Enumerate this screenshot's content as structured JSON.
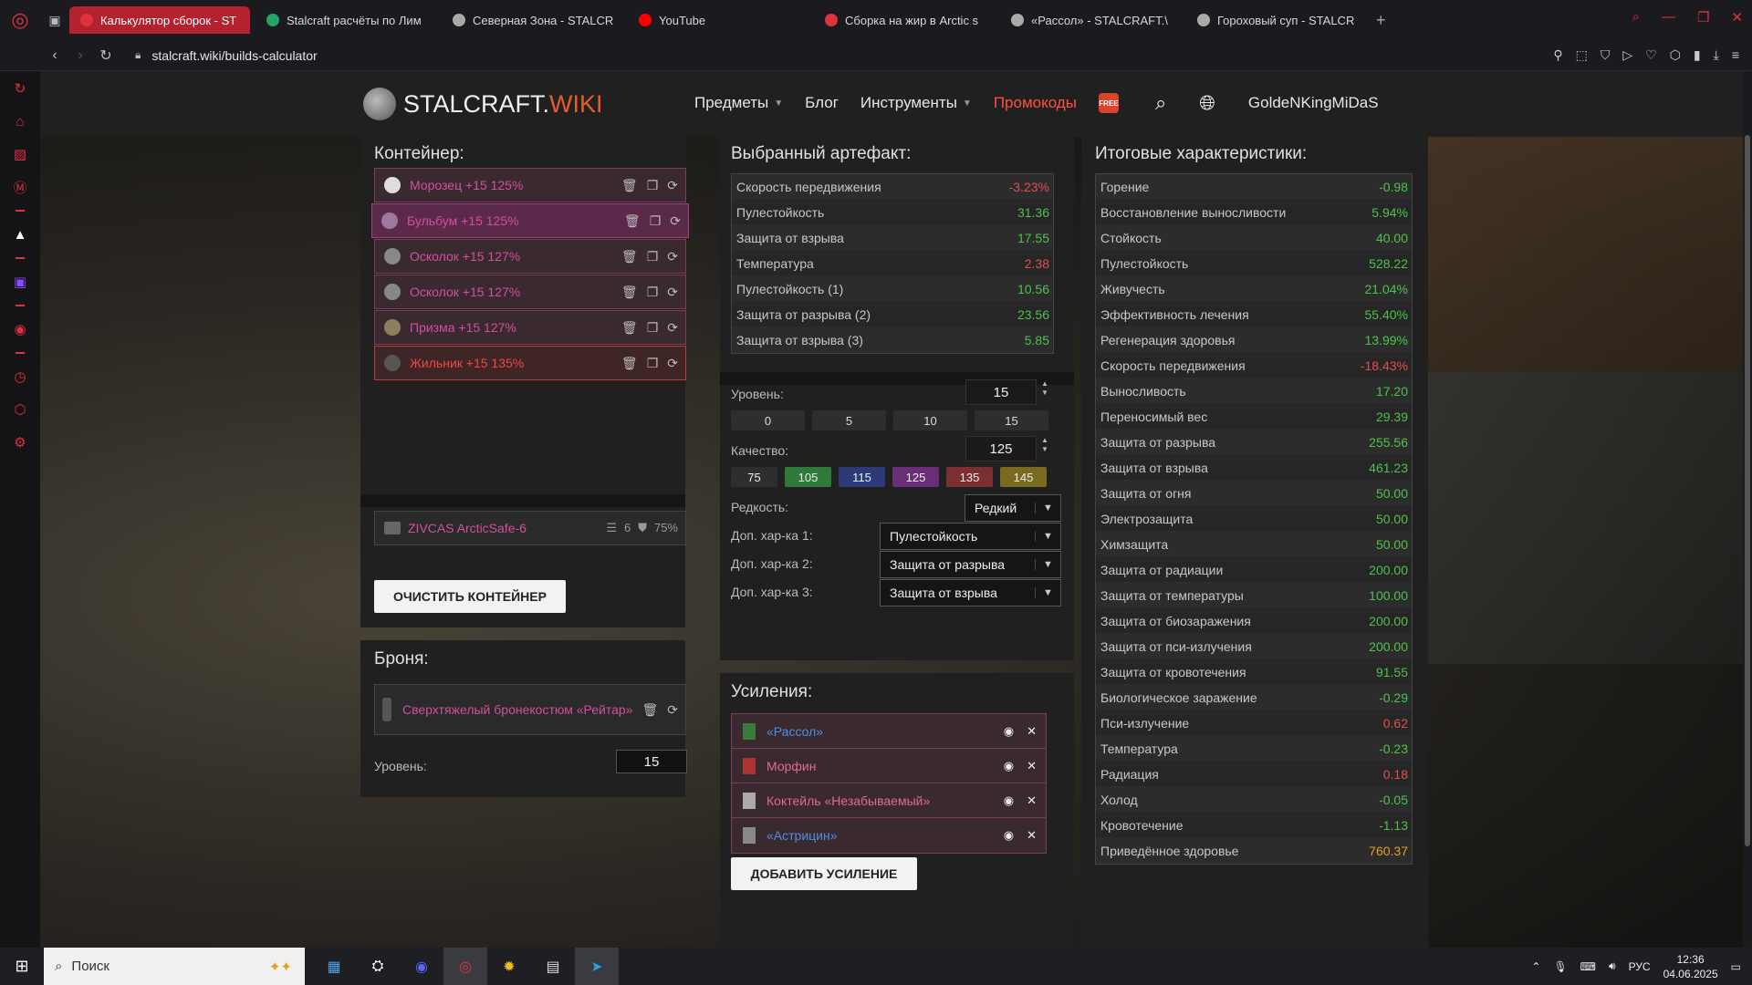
{
  "browser": {
    "tabs": [
      {
        "title": "Калькулятор сборок - ST",
        "active": true,
        "fav_color": "#e0313f"
      },
      {
        "title": "Stalcraft расчёты по Лим",
        "active": false,
        "fav_color": "#22a565"
      },
      {
        "title": "Северная Зона - STALCR",
        "active": false,
        "fav_color": "#aaaaaa"
      },
      {
        "title": "YouTube",
        "active": false,
        "fav_color": "#ff0000"
      },
      {
        "title": "Сборка на жир в Arctic s",
        "active": false,
        "fav_color": "#e0313f"
      },
      {
        "title": "«Рассол» - STALCRAFT.\\",
        "active": false,
        "fav_color": "#aaaaaa"
      },
      {
        "title": "Гороховый суп - STALCR",
        "active": false,
        "fav_color": "#aaaaaa"
      }
    ],
    "new_tab": "+",
    "address": "stalcraft.wiki/builds-calculator"
  },
  "site": {
    "logo_main": "STALCRAFT.",
    "logo_accent": "WIKI",
    "nav": {
      "items": "Предметы",
      "blog": "Блог",
      "tools": "Инструменты",
      "promo": "Промокоды",
      "free": "FREE"
    },
    "username": "GoldeNKingMiDaS"
  },
  "container": {
    "title": "Контейнер:",
    "slots": [
      {
        "name": "Морозец +15 125%",
        "color": "purple",
        "icon": "#dddddd"
      },
      {
        "name": "Бульбум +15 125%",
        "color": "purple",
        "icon": "#9a7aa0"
      },
      {
        "name": "Осколок +15 127%",
        "color": "purple",
        "icon": "#888888"
      },
      {
        "name": "Осколок +15 127%",
        "color": "purple",
        "icon": "#888888"
      },
      {
        "name": "Призма +15 127%",
        "color": "purple",
        "icon": "#8a8060"
      },
      {
        "name": "Жильник +15 135%",
        "color": "red",
        "icon": "#555555"
      }
    ],
    "item_name": "ZIVCAS ArcticSafe-6",
    "item_slots": "6",
    "item_protection": "75%",
    "clear_label": "ОЧИСТИТЬ КОНТЕЙНЕР"
  },
  "armor": {
    "title": "Броня:",
    "name": "Сверхтяжелый бронекостюм «Рейтар»",
    "level_label": "Уровень:",
    "level_value": "15"
  },
  "artifact": {
    "title": "Выбранный артефакт:",
    "stats": [
      {
        "name": "Скорость передвижения",
        "value": "-3.23%",
        "sign": "neg"
      },
      {
        "name": "Пулестойкость",
        "value": "31.36",
        "sign": "pos"
      },
      {
        "name": "Защита от взрыва",
        "value": "17.55",
        "sign": "pos"
      },
      {
        "name": "Температура",
        "value": "2.38",
        "sign": "neg"
      },
      {
        "name": "Пулестойкость (1)",
        "value": "10.56",
        "sign": "pos"
      },
      {
        "name": "Защита от разрыва (2)",
        "value": "23.56",
        "sign": "pos"
      },
      {
        "name": "Защита от взрыва (3)",
        "value": "5.85",
        "sign": "pos"
      }
    ],
    "level_label": "Уровень:",
    "level_value": "15",
    "level_presets": [
      "0",
      "5",
      "10",
      "15"
    ],
    "quality_label": "Качество:",
    "quality_value": "125",
    "quality_presets": [
      {
        "label": "75",
        "color": "#2e2e2e"
      },
      {
        "label": "105",
        "color": "#2f7a3a"
      },
      {
        "label": "115",
        "color": "#2c3a78"
      },
      {
        "label": "125",
        "color": "#6a2e78"
      },
      {
        "label": "135",
        "color": "#7a3030"
      },
      {
        "label": "145",
        "color": "#7a6a20"
      }
    ],
    "rarity_label": "Редкость:",
    "rarity_value": "Редкий",
    "extra1_label": "Доп. хар-ка 1:",
    "extra1_value": "Пулестойкость",
    "extra2_label": "Доп. хар-ка 2:",
    "extra2_value": "Защита от разрыва",
    "extra3_label": "Доп. хар-ка 3:",
    "extra3_value": "Защита от взрыва"
  },
  "boosts": {
    "title": "Усиления:",
    "items": [
      {
        "name": "«Рассол»",
        "color": "blue",
        "icon": "#3a7a3a"
      },
      {
        "name": "Морфин",
        "color": "pink",
        "icon": "#aa3333"
      },
      {
        "name": "Коктейль «Незабываемый»",
        "color": "pink",
        "icon": "#aaaaaa"
      },
      {
        "name": "«Астрицин»",
        "color": "blue",
        "icon": "#888888"
      }
    ],
    "add_label": "ДОБАВИТЬ УСИЛЕНИЕ"
  },
  "totals": {
    "title": "Итоговые характеристики:",
    "stats": [
      {
        "name": "Горение",
        "value": "-0.98",
        "sign": "pos"
      },
      {
        "name": "Восстановление выносливости",
        "value": "5.94%",
        "sign": "pos"
      },
      {
        "name": "Стойкость",
        "value": "40.00",
        "sign": "pos"
      },
      {
        "name": "Пулестойкость",
        "value": "528.22",
        "sign": "pos"
      },
      {
        "name": "Живучесть",
        "value": "21.04%",
        "sign": "pos"
      },
      {
        "name": "Эффективность лечения",
        "value": "55.40%",
        "sign": "pos"
      },
      {
        "name": "Регенерация здоровья",
        "value": "13.99%",
        "sign": "pos"
      },
      {
        "name": "Скорость передвижения",
        "value": "-18.43%",
        "sign": "neg"
      },
      {
        "name": "Выносливость",
        "value": "17.20",
        "sign": "pos"
      },
      {
        "name": "Переносимый вес",
        "value": "29.39",
        "sign": "pos"
      },
      {
        "name": "Защита от разрыва",
        "value": "255.56",
        "sign": "pos"
      },
      {
        "name": "Защита от взрыва",
        "value": "461.23",
        "sign": "pos"
      },
      {
        "name": "Защита от огня",
        "value": "50.00",
        "sign": "pos"
      },
      {
        "name": "Электрозащита",
        "value": "50.00",
        "sign": "pos"
      },
      {
        "name": "Химзащита",
        "value": "50.00",
        "sign": "pos"
      },
      {
        "name": "Защита от радиации",
        "value": "200.00",
        "sign": "pos"
      },
      {
        "name": "Защита от температуры",
        "value": "100.00",
        "sign": "pos"
      },
      {
        "name": "Защита от биозаражения",
        "value": "200.00",
        "sign": "pos"
      },
      {
        "name": "Защита от пси-излучения",
        "value": "200.00",
        "sign": "pos"
      },
      {
        "name": "Защита от кровотечения",
        "value": "91.55",
        "sign": "pos"
      },
      {
        "name": "Биологическое заражение",
        "value": "-0.29",
        "sign": "pos"
      },
      {
        "name": "Пси-излучение",
        "value": "0.62",
        "sign": "neg"
      },
      {
        "name": "Температура",
        "value": "-0.23",
        "sign": "pos"
      },
      {
        "name": "Радиация",
        "value": "0.18",
        "sign": "neg"
      },
      {
        "name": "Холод",
        "value": "-0.05",
        "sign": "pos"
      },
      {
        "name": "Кровотечение",
        "value": "-1.13",
        "sign": "pos"
      },
      {
        "name": "Приведённое здоровье",
        "value": "760.37",
        "sign": "gold"
      }
    ]
  },
  "taskbar": {
    "search_placeholder": "Поиск",
    "lang": "РУС",
    "time": "12:36",
    "date": "04.06.2025"
  }
}
